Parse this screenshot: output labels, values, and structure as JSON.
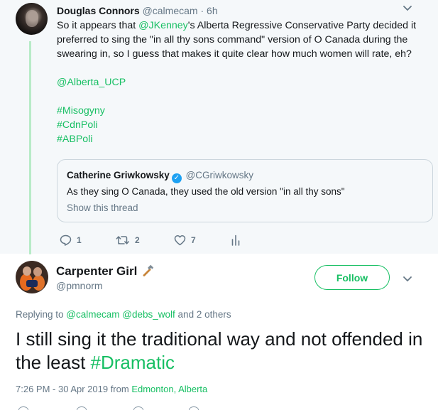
{
  "parent_tweet": {
    "author_name": "Douglas Connors",
    "author_handle": "@calmecam",
    "separator": " · ",
    "time": "6h",
    "text_before_mention": "So it appears that ",
    "mention": "@JKenney",
    "text_after_mention": "'s Alberta Regressive Conservative Party decided it preferred to sing the \"in all thy sons command\" version of O Canada during the swearing in, so I guess that makes it quite clear how much women will rate, eh?",
    "mention_line": "@Alberta_UCP",
    "hashtags": [
      "#Misogyny",
      "#CdnPoli",
      "#ABPoli"
    ],
    "quoted": {
      "author_name": "Catherine Griwkowsky",
      "author_handle": "@CGriwkowsky",
      "text": "As they sing O Canada, they used the old version \"in all thy sons\"",
      "show_thread": "Show this thread"
    },
    "actions": {
      "reply_count": "1",
      "retweet_count": "2",
      "like_count": "7"
    }
  },
  "main_tweet": {
    "author_name": "Carpenter Girl",
    "author_handle": "@pmnorm",
    "follow_label": "Follow",
    "replying_to_prefix": "Replying to ",
    "replying_to_user1": "@calmecam",
    "replying_to_user2": "@debs_wolf",
    "replying_to_suffix": " and 2 others",
    "text": "I still sing it the traditional way and not offended in the least ",
    "hashtag": "#Dramatic",
    "timestamp": "7:26 PM - 30 Apr 2019 from ",
    "location": "Edmonton, Alberta"
  },
  "colors": {
    "accent": "#17bf63",
    "muted": "#657786",
    "text": "#14171a",
    "parent_bg": "#f5f8fa",
    "thread_line": "#b8ebc7",
    "verified": "#1da1f2"
  },
  "icons": {
    "reply": "reply-icon",
    "retweet": "retweet-icon",
    "like": "heart-icon",
    "analytics": "analytics-icon",
    "menu": "chevron-down-icon",
    "emoji": "hammer-icon"
  }
}
